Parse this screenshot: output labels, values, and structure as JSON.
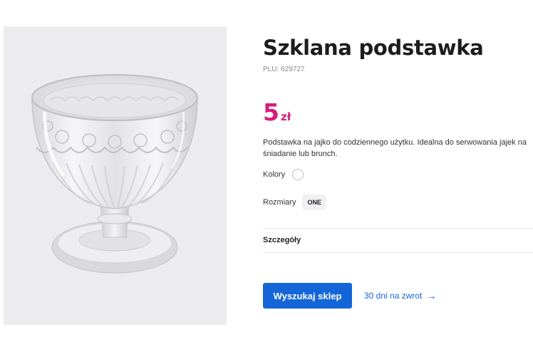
{
  "product": {
    "title": "Szklana podstawka",
    "plu_label": "PLU:",
    "plu_value": "629727",
    "price_amount": "5",
    "price_currency": "zł",
    "description": "Podstawka na jajko do codziennego użytku. Idealna do serwowania jajek na śniadanie lub brunch."
  },
  "options": {
    "colors_label": "Kolory",
    "sizes_label": "Rozmiary",
    "size_value": "ONE"
  },
  "details": {
    "label": "Szczegóły"
  },
  "actions": {
    "find_store_label": "Wyszukaj sklep",
    "return_label": "30 dni na zwrot",
    "return_icon": "arrow-right-icon"
  },
  "colors": {
    "accent_price": "#d81b7d",
    "primary_blue": "#1466d8",
    "image_bg": "#ececee"
  }
}
